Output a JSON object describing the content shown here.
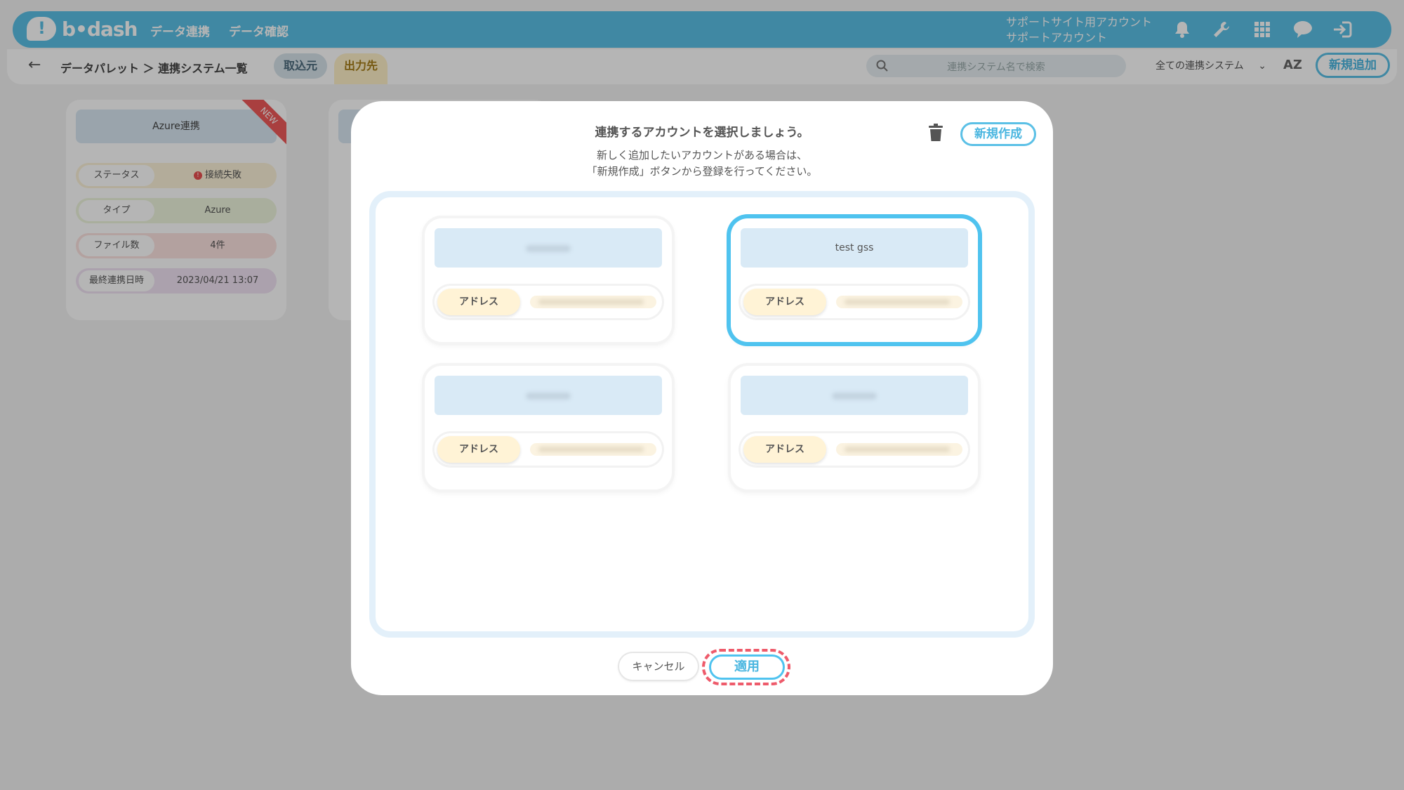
{
  "app": {
    "logo": "b•dash",
    "nav": [
      "データ連携",
      "データ確認"
    ],
    "account_line1": "サポートサイト用アカウント",
    "account_line2": "サポートアカウント",
    "brand_color": "#5bc0e6"
  },
  "subbar": {
    "breadcrumb": "データパレット ＞ 連携システム一覧",
    "tab_import": "取込元",
    "tab_export": "出力先",
    "search_placeholder": "連携システム名で検索",
    "filter_value": "全ての連携システム",
    "sort_label": "AZ",
    "new_button": "新規追加"
  },
  "bg_card": {
    "title": "Azure連携",
    "ribbon": "NEW",
    "status_label": "ステータス",
    "status_value": "接続失敗",
    "type_label": "タイプ",
    "type_value": "Azure",
    "files_label": "ファイル数",
    "files_value": "4件",
    "last_label": "最終連携日時",
    "last_value": "2023/04/21 13:07"
  },
  "modal": {
    "title": "連携するアカウントを選択しましょう。",
    "desc_line1": "新しく追加したいアカウントがある場合は、",
    "desc_line2": "「新規作成」ボタンから登録を行ってください。",
    "new_button": "新規作成",
    "accounts": [
      {
        "name": "",
        "address_label": "アドレス",
        "selected": false
      },
      {
        "name": "test gss",
        "address_label": "アドレス",
        "selected": true
      },
      {
        "name": "",
        "address_label": "アドレス",
        "selected": false
      },
      {
        "name": "",
        "address_label": "アドレス",
        "selected": false
      }
    ],
    "cancel": "キャンセル",
    "apply": "適用",
    "accent_color": "#4fc3ef",
    "highlight_color": "#ee5b6b"
  }
}
